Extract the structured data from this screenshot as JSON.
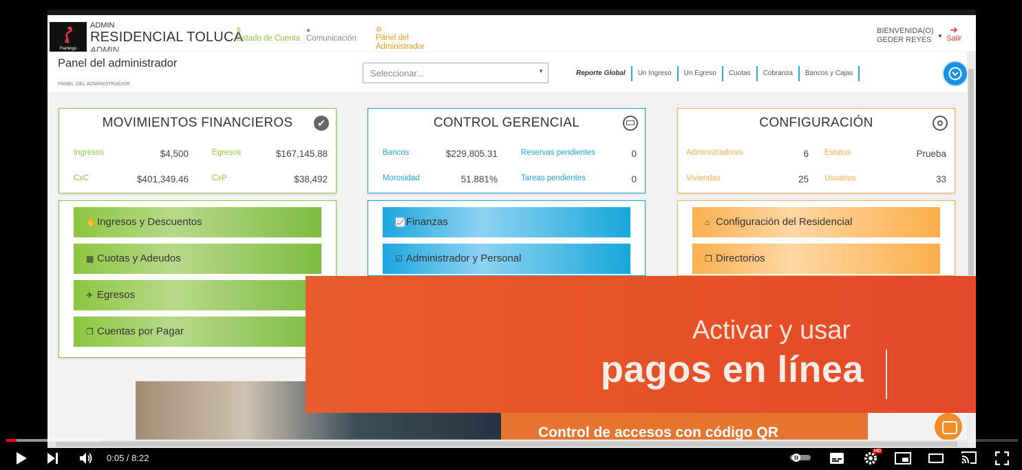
{
  "header": {
    "logo_text": "Flamingo",
    "org_small": "ADMIN",
    "org_name": "RESIDENCIAL TOLUCA",
    "org_role": "ADMIN",
    "nav": [
      {
        "label": "Estado de Cuenta",
        "icon": "dollar-icon",
        "color": "#8dc63f"
      },
      {
        "label": "Comunicación",
        "icon": "chat-icon",
        "color": "#888888"
      },
      {
        "label_line1": "Pánel del",
        "label_line2": "Administrador",
        "icon": "gears-icon",
        "color": "#f39c12"
      }
    ],
    "welcome_line1": "BIENVENIDA(O)",
    "welcome_line2": "GEDER REYES",
    "logout_label": "Salir"
  },
  "subheader": {
    "title": "Panel del administrador",
    "crumb": "PANEL DEL ADMINISTRADOR",
    "select_placeholder": "Seleccionar...",
    "report_links": [
      "Reporte Global",
      "Un Ingreso",
      "Un Egreso",
      "Cuotas",
      "Cobranza",
      "Bancos y Cajas"
    ]
  },
  "cards": {
    "financieros": {
      "title": "MOVIMIENTOS FINANCIEROS",
      "color": "#8dc63f",
      "stats": [
        {
          "label": "Ingresos",
          "value": "$4,500"
        },
        {
          "label": "Egresos",
          "value": "$167,145.88"
        },
        {
          "label": "CxC",
          "value": "$401,349.46"
        },
        {
          "label": "CxP",
          "value": "$38,492"
        }
      ],
      "buttons": [
        "Ingresos y Descuentos",
        "Cuotas y Adeudos",
        "Egresos",
        "Cuentas por Pagar"
      ]
    },
    "gerencial": {
      "title": "CONTROL GERENCIAL",
      "color": "#1da6df",
      "stats": [
        {
          "label": "Bancos",
          "value": "$229,805.31"
        },
        {
          "label": "Reservas pendientes",
          "value": "0"
        },
        {
          "label": "Morosidad",
          "value": "51.881%"
        },
        {
          "label": "Tareas pendientes",
          "value": "0"
        }
      ],
      "buttons": [
        "Finanzas",
        "Administrador y Personal"
      ]
    },
    "configuracion": {
      "title": "CONFIGURACIÓN",
      "color": "#fbae4a",
      "stats": [
        {
          "label": "Administradores",
          "value": "6"
        },
        {
          "label": "Estatus",
          "value": "Prueba"
        },
        {
          "label": "Viviendas",
          "value": "25"
        },
        {
          "label": "Usuarios",
          "value": "33"
        }
      ],
      "buttons": [
        "Configuración del Residencial",
        "Directorios"
      ]
    }
  },
  "overlay": {
    "line1": "Activar y usar",
    "line2": "pagos en línea",
    "qr_text": "Control de accesos con código QR"
  },
  "player": {
    "time": "0:05 / 8:22",
    "progress_played": 0.01,
    "progress_buffered": 0.095,
    "hd_badge": "HD"
  }
}
